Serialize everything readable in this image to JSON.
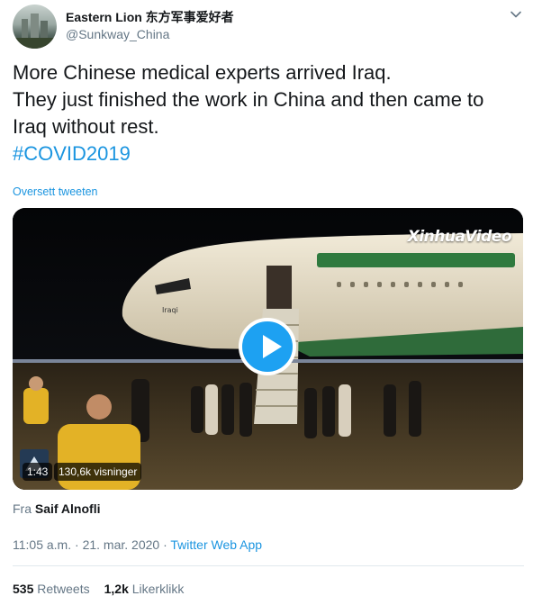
{
  "author": {
    "display_name": "Eastern Lion 东方军事爱好者",
    "handle": "@Sunkway_China"
  },
  "tweet": {
    "lines": [
      "More Chinese medical experts arrived Iraq.",
      "They just finished the work in China and then came to",
      "Iraq without rest."
    ],
    "hashtag": "#COVID2019",
    "translate_label": "Oversett tweeten"
  },
  "media": {
    "watermark": "XinhuaVideo",
    "plane_text": "Iraqi",
    "duration": "1:43",
    "views": "130,6k visninger"
  },
  "source": {
    "prefix": "Fra",
    "name": "Saif Alnofli"
  },
  "meta": {
    "time": "11:05 a.m.",
    "separator": "·",
    "date": "21. mar. 2020",
    "app": "Twitter Web App"
  },
  "stats": {
    "retweets_count": "535",
    "retweets_label": "Retweets",
    "likes_count": "1,2k",
    "likes_label": "Likerklikk"
  },
  "colors": {
    "link": "#1b95e0",
    "play_button": "#1da1f2",
    "text_secondary": "#657786"
  }
}
